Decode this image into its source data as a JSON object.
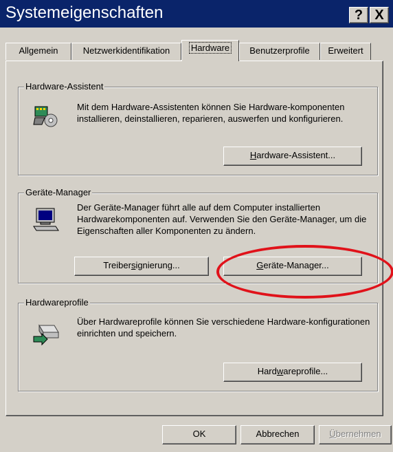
{
  "window": {
    "title": "Systemeigenschaften"
  },
  "titlebar": {
    "help": "?",
    "close": "X"
  },
  "tabs": [
    {
      "label": "Allgemein"
    },
    {
      "label": "Netzwerkidentifikation"
    },
    {
      "label": "Hardware"
    },
    {
      "label": "Benutzerprofile"
    },
    {
      "label": "Erweitert"
    }
  ],
  "hardware_wizard": {
    "title": "Hardware-Assistent",
    "text": "Mit dem Hardware-Assistenten können Sie Hardware-komponenten installieren, deinstallieren, reparieren, auswerfen und konfigurieren.",
    "button_pre": "",
    "button_u": "H",
    "button_post": "ardware-Assistent..."
  },
  "device_manager": {
    "title": "Geräte-Manager",
    "text": "Der Geräte-Manager führt alle auf dem Computer installierten Hardwarekomponenten auf. Verwenden Sie den Geräte-Manager, um die Eigenschaften aller Komponenten zu ändern.",
    "driver_pre": "Treiber",
    "driver_u": "s",
    "driver_post": "ignierung...",
    "dm_pre": "",
    "dm_u": "G",
    "dm_post": "eräte-Manager..."
  },
  "hardware_profiles": {
    "title": "Hardwareprofile",
    "text": "Über Hardwareprofile können Sie verschiedene Hardware-konfigurationen einrichten und speichern.",
    "button_pre": "Hard",
    "button_u": "w",
    "button_post": "areprofile..."
  },
  "footer": {
    "ok": "OK",
    "cancel": "Abbrechen",
    "apply_u": "Ü",
    "apply_post": "bernehmen"
  },
  "colors": {
    "titlebar": "#0a246a",
    "face": "#d4d0c8",
    "highlight_ellipse": "#e0121a"
  }
}
